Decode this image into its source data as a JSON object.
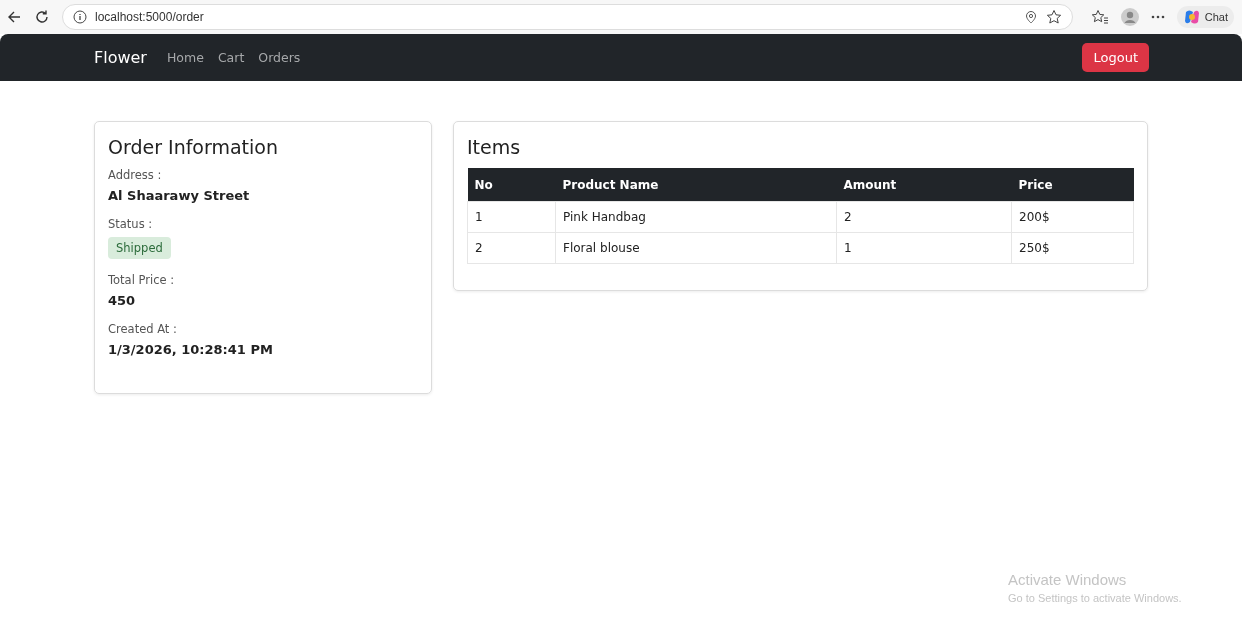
{
  "browser": {
    "url": "localhost:5000/order",
    "chat_label": "Chat"
  },
  "navbar": {
    "brand": "Flower",
    "links": [
      "Home",
      "Cart",
      "Orders"
    ],
    "logout": "Logout"
  },
  "order_info": {
    "title": "Order Information",
    "fields": [
      {
        "label": "Address :",
        "value": "Al Shaarawy Street"
      },
      {
        "label": "Status :",
        "badge": "Shipped",
        "kind": "success"
      },
      {
        "label": "Total Price :",
        "value": "450"
      },
      {
        "label": "Created At :",
        "value": "1/3/2026, 10:28:41 PM"
      }
    ]
  },
  "items": {
    "title": "Items",
    "columns": [
      "No",
      "Product Name",
      "Amount",
      "Price"
    ],
    "rows": [
      [
        "1",
        "Pink Handbag",
        "2",
        "200$"
      ],
      [
        "2",
        "Floral blouse",
        "1",
        "250$"
      ]
    ]
  },
  "os_notice": {
    "title": "Activate Windows",
    "text": "Go to Settings to activate Windows."
  }
}
